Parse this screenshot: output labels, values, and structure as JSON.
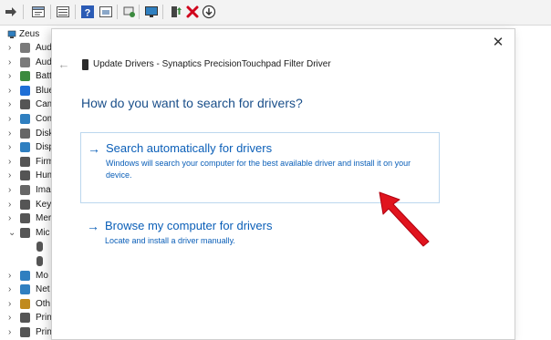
{
  "toolbar": {
    "icons": [
      "forward-arrow-icon",
      "properties-icon",
      "view-icon",
      "help-icon",
      "refresh-icon",
      "scan-hardware-icon",
      "monitor-icon",
      "update-driver-icon",
      "uninstall-icon",
      "download-icon"
    ],
    "colors": {
      "uninstall": "#d0021b",
      "help": "#2b5bb5"
    }
  },
  "tree": {
    "root_label": "Zeus",
    "items": [
      {
        "label": "Aud",
        "icon": "audio-icon",
        "color": "#7a7a7a",
        "expanded": false
      },
      {
        "label": "Aud",
        "icon": "audio-icon",
        "color": "#7a7a7a",
        "expanded": false
      },
      {
        "label": "Batt",
        "icon": "battery-icon",
        "color": "#3b8a3e",
        "expanded": false
      },
      {
        "label": "Blue",
        "icon": "bluetooth-icon",
        "color": "#1f6fd6",
        "expanded": false
      },
      {
        "label": "Cam",
        "icon": "camera-icon",
        "color": "#555555",
        "expanded": false
      },
      {
        "label": "Com",
        "icon": "computer-icon",
        "color": "#2f7fc0",
        "expanded": false
      },
      {
        "label": "Disk",
        "icon": "disk-icon",
        "color": "#666666",
        "expanded": false
      },
      {
        "label": "Disp",
        "icon": "display-icon",
        "color": "#2f7fc0",
        "expanded": false
      },
      {
        "label": "Firm",
        "icon": "firmware-icon",
        "color": "#555555",
        "expanded": false
      },
      {
        "label": "Hum",
        "icon": "hid-icon",
        "color": "#555555",
        "expanded": false
      },
      {
        "label": "Ima",
        "icon": "imaging-icon",
        "color": "#666666",
        "expanded": false
      },
      {
        "label": "Key",
        "icon": "keyboard-icon",
        "color": "#555555",
        "expanded": false
      },
      {
        "label": "Mer",
        "icon": "memory-icon",
        "color": "#555555",
        "expanded": false
      },
      {
        "label": "Mic",
        "icon": "mouse-icon",
        "color": "#555555",
        "expanded": true
      },
      {
        "label": "",
        "icon": "mouse-icon",
        "color": "#555555",
        "child": true
      },
      {
        "label": "",
        "icon": "mouse-icon",
        "color": "#555555",
        "child": true
      },
      {
        "label": "Mo",
        "icon": "monitor-icon",
        "color": "#2f7fc0",
        "expanded": false
      },
      {
        "label": "Net",
        "icon": "network-icon",
        "color": "#2f7fc0",
        "expanded": false
      },
      {
        "label": "Oth",
        "icon": "other-devices-icon",
        "color": "#c08a1e",
        "expanded": false
      },
      {
        "label": "Prin",
        "icon": "printer-icon",
        "color": "#555555",
        "expanded": false
      },
      {
        "label": "Prin",
        "icon": "printer-icon",
        "color": "#555555",
        "expanded": false
      }
    ]
  },
  "dialog": {
    "title": "Update Drivers - Synaptics PrecisionTouchpad Filter Driver",
    "close_glyph": "✕",
    "back_glyph": "←",
    "heading": "How do you want to search for drivers?",
    "option1": {
      "arrow": "→",
      "title": "Search automatically for drivers",
      "description": "Windows will search your computer for the best available driver and install it on your device."
    },
    "option2": {
      "arrow": "→",
      "title": "Browse my computer for drivers",
      "description": "Locate and install a driver manually."
    },
    "link_color": "#0b5fb8",
    "annotation_color": "#e0141e"
  }
}
